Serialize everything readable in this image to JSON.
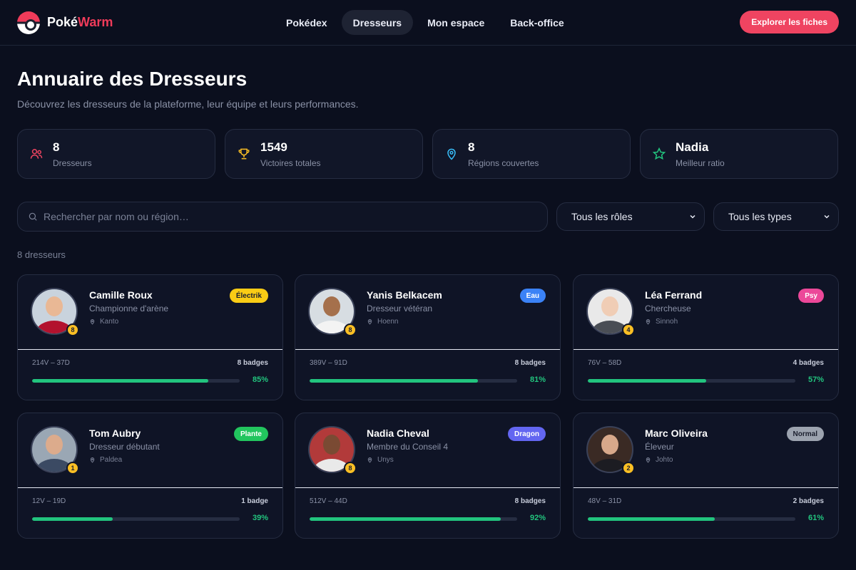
{
  "nav": {
    "logo_part1": "Poké",
    "logo_part2": "Warm",
    "links": [
      "Pokédex",
      "Dresseurs",
      "Mon espace",
      "Back-office"
    ],
    "active": 1,
    "cta": "Explorer les fiches"
  },
  "header": {
    "title": "Annuaire des Dresseurs",
    "subtitle": "Découvrez les dresseurs de la plateforme, leur équipe et leurs performances."
  },
  "stats": [
    {
      "value": "8",
      "label": "Dresseurs",
      "icon": "users-icon",
      "color": "#ef4461"
    },
    {
      "value": "1549",
      "label": "Victoires totales",
      "icon": "trophy-icon",
      "color": "#fbbf24"
    },
    {
      "value": "8",
      "label": "Régions couvertes",
      "icon": "map-pin-icon",
      "color": "#38bdf8"
    },
    {
      "value": "Nadia",
      "label": "Meilleur ratio",
      "icon": "star-icon",
      "color": "#22c47e"
    }
  ],
  "filters": {
    "search_placeholder": "Rechercher par nom ou région…",
    "role": "Tous les rôles",
    "type": "Tous les types"
  },
  "count_label": "8 dresseurs",
  "trainers": [
    {
      "name": "Camille Roux",
      "role": "Championne d'arène",
      "region": "Kanto",
      "type": "Électrik",
      "type_bg": "#facc15",
      "type_fg": "#1b1f2e",
      "level": "8",
      "record": "214V – 37D",
      "badges": "8 badges",
      "ratio": 85,
      "ratio_label": "85%",
      "skin": "#e9b895",
      "shirt": "#b3122e",
      "bg": "#c9d3dd"
    },
    {
      "name": "Yanis Belkacem",
      "role": "Dresseur vétéran",
      "region": "Hoenn",
      "type": "Eau",
      "type_bg": "#3b82f6",
      "type_fg": "#ffffff",
      "level": "8",
      "record": "389V – 91D",
      "badges": "8 badges",
      "ratio": 81,
      "ratio_label": "81%",
      "skin": "#a5704c",
      "shirt": "#f3f3f3",
      "bg": "#d7dde2"
    },
    {
      "name": "Léa Ferrand",
      "role": "Chercheuse",
      "region": "Sinnoh",
      "type": "Psy",
      "type_bg": "#ec4899",
      "type_fg": "#ffffff",
      "level": "4",
      "record": "76V – 58D",
      "badges": "4 badges",
      "ratio": 57,
      "ratio_label": "57%",
      "skin": "#f0cdb5",
      "shirt": "#4a4e55",
      "bg": "#e9e9e9"
    },
    {
      "name": "Tom Aubry",
      "role": "Dresseur débutant",
      "region": "Paldea",
      "type": "Plante",
      "type_bg": "#22c55e",
      "type_fg": "#ffffff",
      "level": "1",
      "record": "12V – 19D",
      "badges": "1 badge",
      "ratio": 39,
      "ratio_label": "39%",
      "skin": "#dcab8c",
      "shirt": "#3b4a63",
      "bg": "#9aa7b4"
    },
    {
      "name": "Nadia Cheval",
      "role": "Membre du Conseil 4",
      "region": "Unys",
      "type": "Dragon",
      "type_bg": "#6366f1",
      "type_fg": "#ffffff",
      "level": "8",
      "record": "512V – 44D",
      "badges": "8 badges",
      "ratio": 92,
      "ratio_label": "92%",
      "skin": "#7a4a33",
      "shirt": "#e9e9e9",
      "bg": "#b23a3a"
    },
    {
      "name": "Marc Oliveira",
      "role": "Éleveur",
      "region": "Johto",
      "type": "Normal",
      "type_bg": "#9ca3af",
      "type_fg": "#1b1f2e",
      "level": "2",
      "record": "48V – 31D",
      "badges": "2 badges",
      "ratio": 61,
      "ratio_label": "61%",
      "skin": "#d8a88a",
      "shirt": "#1c1c22",
      "bg": "#3a2a24"
    }
  ]
}
